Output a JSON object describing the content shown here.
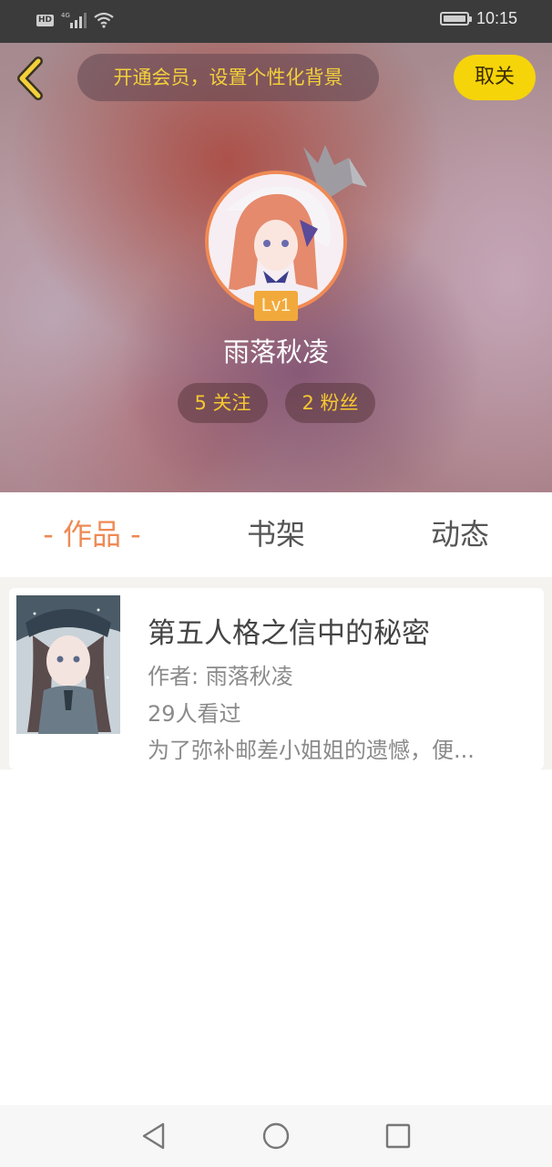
{
  "status_bar": {
    "left_badge": "HD",
    "network": "4G",
    "time": "10:15",
    "icons": [
      "hd-icon",
      "signal-icon",
      "wifi-icon",
      "battery-icon"
    ]
  },
  "header": {
    "vip_prompt": "开通会员，设置个性化背景",
    "cancel_label": "取关",
    "level_badge": "Lv1",
    "username": "雨落秋凌",
    "stats": {
      "following": "5 关注",
      "fans": "2 粉丝"
    },
    "colors": {
      "accent_yellow": "#f5d40a",
      "text_yellow": "#f3d03b",
      "avatar_ring": "#f08a55",
      "level_badge": "#f2a93c"
    }
  },
  "tabs": [
    {
      "label": "- 作品 -",
      "active": true
    },
    {
      "label": "书架",
      "active": false
    },
    {
      "label": "动态",
      "active": false
    }
  ],
  "works": [
    {
      "title": "第五人格之信中的秘密",
      "author": "作者: 雨落秋凌",
      "views": "29人看过",
      "description": "为了弥补邮差小姐姐的遗憾，便..."
    }
  ],
  "nav_bar": {
    "icons": [
      "nav-back-icon",
      "nav-home-icon",
      "nav-recent-icon"
    ]
  },
  "theme": {
    "active_tab": "#ee8a55",
    "tab_text": "#555555"
  }
}
